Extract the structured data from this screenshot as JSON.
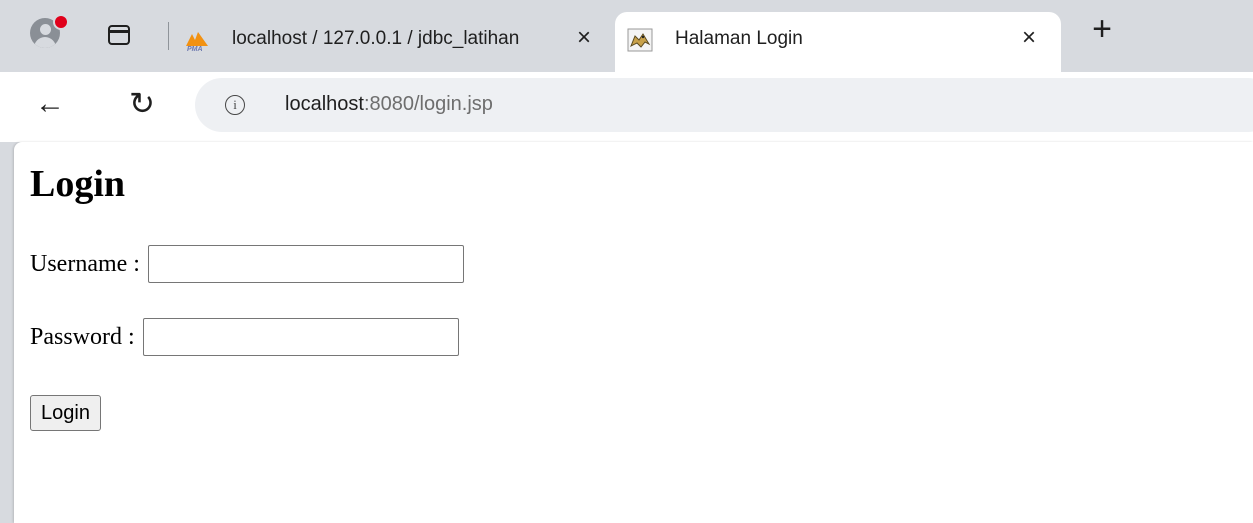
{
  "browser": {
    "tabs": [
      {
        "title": "localhost / 127.0.0.1 / jdbc_latihan",
        "icon": "phpmyadmin-icon",
        "active": false
      },
      {
        "title": "Halaman Login",
        "icon": "tomcat-icon",
        "active": true
      }
    ],
    "close_glyph": "×",
    "new_tab_glyph": "+",
    "back_glyph": "←",
    "reload_glyph": "↻",
    "info_glyph": "i",
    "url_host": "localhost",
    "url_rest": ":8080/login.jsp"
  },
  "page": {
    "heading": "Login",
    "username_label": "Username :",
    "username_value": "",
    "password_label": "Password :",
    "password_value": "",
    "login_button": "Login"
  },
  "colors": {
    "tabstrip": "#d7dadf",
    "profile_badge": "#e0001b",
    "pma_orange": "#f29111",
    "pma_blue": "#6c78af"
  }
}
